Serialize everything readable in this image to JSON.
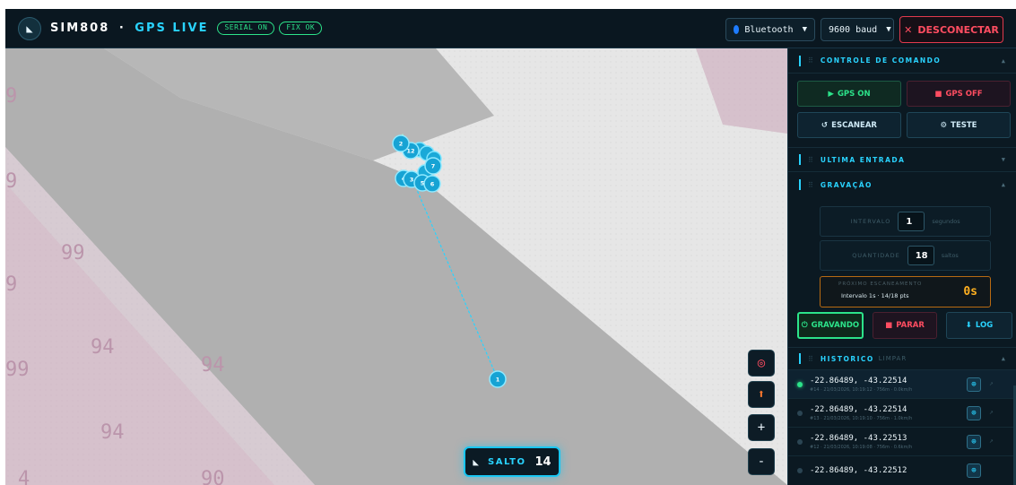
{
  "header": {
    "logo_icon": "satellite-dish-icon",
    "title_main": "SIM808",
    "title_sep": "·",
    "title_accent": "GPS LIVE",
    "pill_serial": "SERIAL ON",
    "pill_fix": "FIX OK",
    "connection_select": "Bluetooth",
    "baud_select": "9600 baud",
    "disconnect_label": "DESCONECTAR"
  },
  "map": {
    "marker_labels": [
      "12",
      "2",
      "7",
      "4",
      "3",
      "5",
      "6",
      "1"
    ],
    "controls": {
      "recenter_icon": "target-icon",
      "pin_icon": "pin-icon",
      "zoom_in": "+",
      "zoom_out": "-"
    },
    "jump_label": "SALTO",
    "jump_value": "14"
  },
  "panel": {
    "command": {
      "title": "CONTROLE DE COMANDO",
      "toggle": "▲",
      "gps_on": "GPS ON",
      "gps_off": "GPS OFF",
      "scan": "ESCANEAR",
      "test": "TESTE"
    },
    "last_entry": {
      "title": "ULTIMA ENTRADA",
      "toggle": "▼"
    },
    "recording": {
      "title": "GRAVAÇÃO",
      "toggle": "▲",
      "interval_label": "INTERVALO",
      "interval_value": "1",
      "interval_unit": "segundos",
      "count_label": "QUANTIDADE",
      "count_value": "18",
      "count_unit": "saltos",
      "next_label": "PRÓXIMO ESCANEAMENTO",
      "next_sub": "Intervalo 1s · 14/18 pts",
      "next_value": "0s",
      "btn_recording": "GRAVANDO",
      "btn_stop": "PARAR",
      "btn_log": "LOG"
    },
    "history": {
      "title": "HISTORICO",
      "clear": "LIMPAR",
      "toggle": "▲",
      "items": [
        {
          "coords": "-22.86489, -43.22514",
          "meta": "#14 · 21/03/2026, 10:19:12 · 756m · 0.0km/h"
        },
        {
          "coords": "-22.86489, -43.22514",
          "meta": "#13 · 21/03/2026, 10:19:10 · 756m · 1.0km/h"
        },
        {
          "coords": "-22.86489, -43.22513",
          "meta": "#12 · 21/03/2026, 10:19:08 · 756m · 0.6km/h"
        },
        {
          "coords": "-22.86489, -43.22512",
          "meta": ""
        }
      ]
    }
  }
}
